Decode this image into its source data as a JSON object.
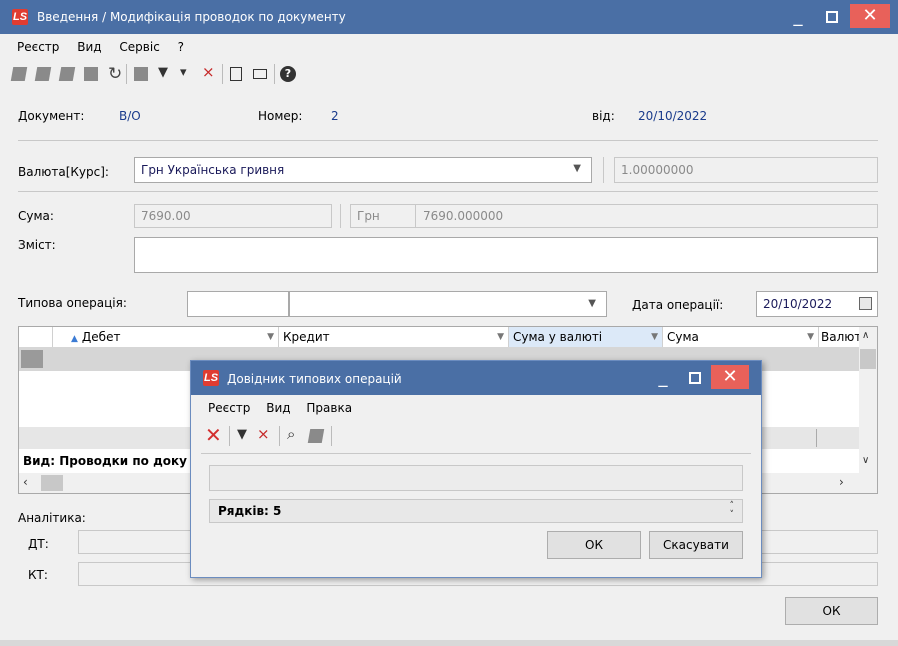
{
  "window": {
    "title": "Введення / Модифікація проводок по документу",
    "logo": "LS"
  },
  "menu": [
    "Реєстр",
    "Вид",
    "Сервіс",
    "?"
  ],
  "toolbar_icons": [
    "doc-add-icon",
    "doc-edit-icon",
    "doc-copy-icon",
    "doc-stack-icon",
    "refresh-icon",
    "stop-icon",
    "filter-icon",
    "filter-settings-icon",
    "filter-clear-icon",
    "form-icon",
    "mail-icon",
    "help-icon"
  ],
  "doc": {
    "label": "Документ:",
    "value": "В/О",
    "number_label": "Номер:",
    "number": "2",
    "date_label": "від:",
    "date": "20/10/2022"
  },
  "currency": {
    "label": "Валюта[Курс]:",
    "value": "Грн Українська гривня",
    "rate": "1.00000000"
  },
  "sum": {
    "label": "Сума:",
    "value": "7690.00",
    "unit": "Грн",
    "converted": "7690.000000"
  },
  "content": {
    "label": "Зміст:",
    "value": ""
  },
  "operation": {
    "label": "Типова операція:",
    "code": "",
    "name": "",
    "date_label": "Дата операції:",
    "date": "20/10/2022"
  },
  "grid": {
    "columns": [
      "Дебет",
      "Кредит",
      "Сума у валюті",
      "Сума",
      "Валют"
    ],
    "footer": "Вид: Проводки по доку"
  },
  "analytics": {
    "label": "Аналітика:",
    "dt": "ДТ:",
    "kt": "КТ:"
  },
  "ok_label": "ОК",
  "dialog": {
    "title": "Довідник типових операцій",
    "logo": "LS",
    "menu": [
      "Реєстр",
      "Вид",
      "Правка"
    ],
    "search": "",
    "rows_label": "Рядків: 5",
    "ok_label": "ОК",
    "cancel_label": "Скасувати"
  },
  "colors": {
    "title_bar": "#4a6fa5",
    "close": "#e8615a",
    "logo": "#e03c31",
    "blue_text": "#1a3b8c"
  }
}
